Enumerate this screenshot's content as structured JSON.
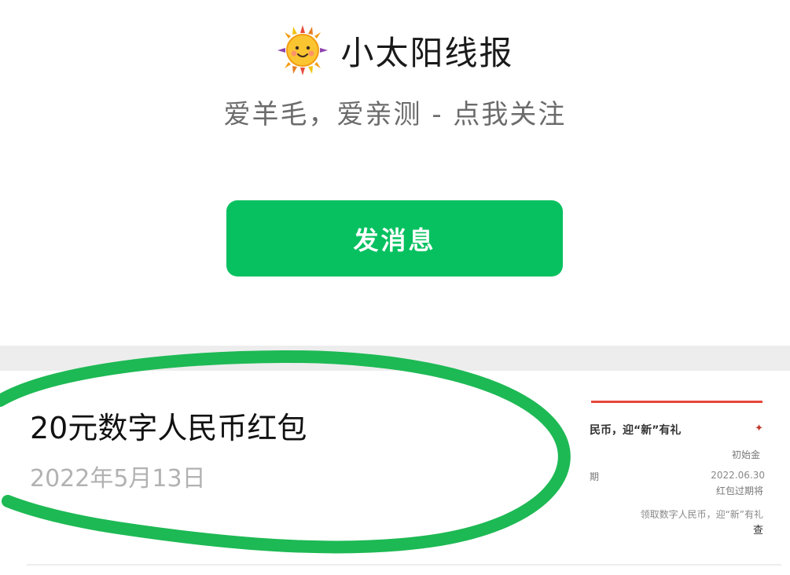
{
  "account": {
    "name": "小太阳线报",
    "tagline": "爱羊毛，爱亲测 - 点我关注",
    "logo_icon": "smiling-sun-icon"
  },
  "actions": {
    "send_message_label": "发消息"
  },
  "article": {
    "title": "20元数字人民币红包",
    "date": "2022年5月13日",
    "thumbnail": {
      "line1": "民币，迎“新”有礼",
      "line2": "初始金",
      "line3_left": "期",
      "line3_right": "2022.06.30",
      "line4": "红包过期将",
      "line5": "领取数字人民币，迎“新”有礼",
      "line6": "查"
    }
  },
  "colors": {
    "accent_green": "#07c160",
    "annotation_green": "#1db954",
    "thumbnail_red": "#e8473c"
  }
}
